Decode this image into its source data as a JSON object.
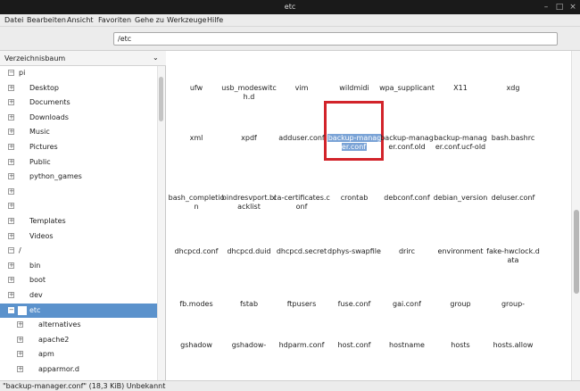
{
  "window": {
    "title": "etc"
  },
  "menu": [
    "Datei",
    "Bearbeiten",
    "Ansicht",
    "Favoriten",
    "Gehe zu",
    "Werkzeuge",
    "Hilfe"
  ],
  "location": {
    "path": "/etc"
  },
  "sidebar": {
    "header": "Verzeichnisbaum",
    "tree": [
      {
        "label": "pi",
        "exp": "−",
        "depth": 0
      },
      {
        "label": "Desktop",
        "exp": "+",
        "depth": 1
      },
      {
        "label": "Documents",
        "exp": "+",
        "depth": 1
      },
      {
        "label": "Downloads",
        "exp": "+",
        "depth": 1
      },
      {
        "label": "Music",
        "exp": "+",
        "depth": 1
      },
      {
        "label": "Pictures",
        "exp": "+",
        "depth": 1
      },
      {
        "label": "Public",
        "exp": "+",
        "depth": 1
      },
      {
        "label": "python_games",
        "exp": "+",
        "depth": 1
      },
      {
        "label": "",
        "exp": "+",
        "depth": 1
      },
      {
        "label": "",
        "exp": "+",
        "depth": 1
      },
      {
        "label": "Templates",
        "exp": "+",
        "depth": 1
      },
      {
        "label": "Videos",
        "exp": "+",
        "depth": 1
      },
      {
        "label": "/",
        "exp": "−",
        "depth": 0
      },
      {
        "label": "bin",
        "exp": "+",
        "depth": 1
      },
      {
        "label": "boot",
        "exp": "+",
        "depth": 1
      },
      {
        "label": "dev",
        "exp": "+",
        "depth": 1
      },
      {
        "label": "etc",
        "exp": "−",
        "depth": 1,
        "selected": true
      },
      {
        "label": "alternatives",
        "exp": "+",
        "depth": 2
      },
      {
        "label": "apache2",
        "exp": "+",
        "depth": 2
      },
      {
        "label": "apm",
        "exp": "+",
        "depth": 2
      },
      {
        "label": "apparmor.d",
        "exp": "+",
        "depth": 2
      },
      {
        "label": "",
        "exp": "+",
        "depth": 2
      }
    ]
  },
  "files": [
    [
      "ufw",
      "usb_modeswitch.d",
      "vim",
      "wildmidi",
      "wpa_supplicant",
      "X11",
      "xdg"
    ],
    [
      "xml",
      "xpdf",
      "adduser.conf",
      "backup-manager.conf",
      "backup-manager.conf.old",
      "backup-manager.conf.ucf-old",
      "bash.bashrc"
    ],
    [
      "bash_completion",
      "bindresvport.blacklist",
      "ca-certificates.conf",
      "crontab",
      "debconf.conf",
      "debian_version",
      "deluser.conf"
    ],
    [
      "dhcpcd.conf",
      "dhcpcd.duid",
      "dhcpcd.secret",
      "dphys-swapfile",
      "drirc",
      "environment",
      "fake-hwclock.data"
    ],
    [
      "fb.modes",
      "fstab",
      "ftpusers",
      "fuse.conf",
      "gai.conf",
      "group",
      "group-"
    ],
    [
      "gshadow",
      "gshadow-",
      "hdparm.conf",
      "host.conf",
      "hostname",
      "hosts",
      "hosts.allow"
    ]
  ],
  "selected_file": "backup-manager.conf",
  "status": "\"backup-manager.conf\" (18,3 KiB) Unbekannt",
  "colors": {
    "selection": "#5b92cc",
    "highlight": "#d2232a"
  }
}
